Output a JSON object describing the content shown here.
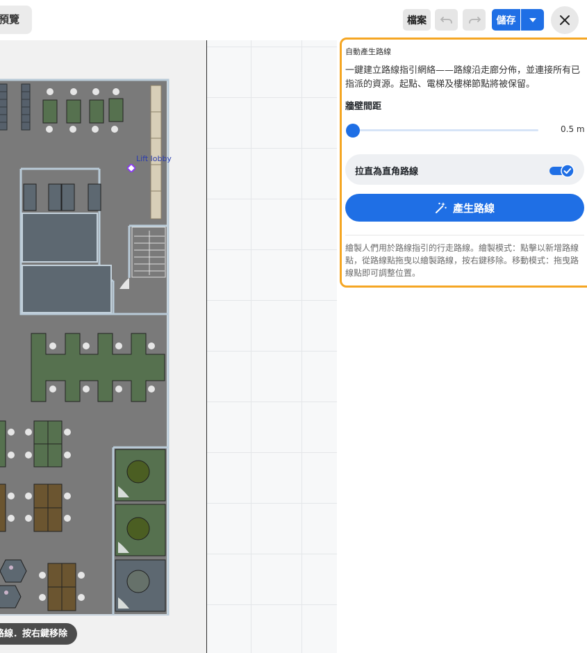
{
  "topbar": {
    "preview_label": "預覽",
    "file_label": "檔案",
    "save_label": "儲存",
    "undo_icon": "undo-icon",
    "redo_icon": "redo-icon",
    "save_dropdown_icon": "chevron-down-icon",
    "close_icon": "close-icon"
  },
  "canvas": {
    "marker_label": "Lift lobby",
    "hint": "路線．按右鍵移除"
  },
  "panel": {
    "title": "自動產生路線",
    "description": "一鍵建立路線指引網絡——路線沿走廊分佈，並連接所有已指派的資源。起點、電梯及樓梯節點將被保留。",
    "wall_spacing_label": "牆壁間距",
    "wall_spacing_value": "0.5 m",
    "wall_spacing_level": 0.0,
    "straighten_label": "拉直為直角路線",
    "straighten_enabled": true,
    "generate_label": "產生路線",
    "generate_icon": "magic-wand-icon",
    "help": "繪製人們用於路線指引的行走路線。繪製模式：點擊以新增路線點，從路線點拖曳以繪製路線，按右鍵移除。移動模式：拖曳路線點即可調整位置。"
  },
  "colors": {
    "accent": "#1f6fe5",
    "panel_border": "#f5a623",
    "floor": "#7a7a7a",
    "desk_green": "#56714f",
    "desk_brown": "#6b5530",
    "table_olive": "#4b5e22"
  }
}
